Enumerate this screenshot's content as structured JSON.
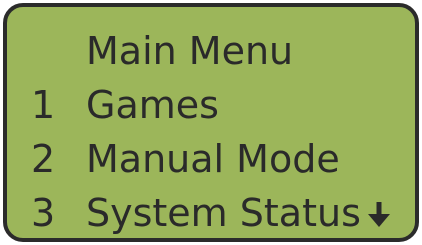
{
  "menu": {
    "title": "Main Menu",
    "items": [
      {
        "number": "1",
        "label": "Games"
      },
      {
        "number": "2",
        "label": "Manual Mode"
      },
      {
        "number": "3",
        "label": "System Status"
      }
    ],
    "scroll_indicator_icon": "arrow-down-icon"
  },
  "colors": {
    "lcd_background": "#9cb65a",
    "lcd_border": "#2b2b2b",
    "text": "#2a2a2a"
  }
}
